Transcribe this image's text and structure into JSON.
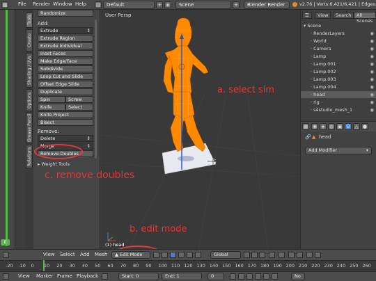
{
  "topbar": {
    "menus": [
      "File",
      "Render",
      "Window",
      "Help"
    ],
    "layout": "Default",
    "scene": "Scene",
    "engine": "Blender Render",
    "stats": "v2.76 | Verts:6,421/6,421 | Edges:16,"
  },
  "tabs": [
    "Tools",
    "Create",
    "Shading / UVs",
    "Options",
    "Grease Pencil",
    "Relations"
  ],
  "toolshelf": {
    "top_button": "Randomize",
    "add_label": "Add:",
    "add_buttons": [
      "Extrude",
      "Extrude Region",
      "Extrude Individual",
      "Inset Faces",
      "Make Edge/Face",
      "Subdivide",
      "Loop Cut and Slide",
      "Offset Edge Slide",
      "Duplicate"
    ],
    "pairs": [
      [
        "Spin",
        "Screw"
      ],
      [
        "Knife",
        "Select"
      ]
    ],
    "more_buttons": [
      "Knife Project",
      "Bisect"
    ],
    "remove_label": "Remove:",
    "delete": "Delete",
    "merge": "Merge",
    "remove_doubles": "Remove Doubles",
    "weight_tools": "Weight Tools"
  },
  "viewport": {
    "label": "User Persp",
    "object_name": "(1) head"
  },
  "annotations": {
    "a": "a. select sim",
    "b": "b. edit mode",
    "c": "c. remove doubles"
  },
  "outliner": {
    "tabs": [
      "View",
      "Search",
      "All Scenes"
    ],
    "rows": [
      {
        "name": "Scene",
        "indent": 0,
        "selected": false
      },
      {
        "name": "RenderLayers",
        "indent": 1,
        "selected": false
      },
      {
        "name": "World",
        "indent": 1,
        "selected": false
      },
      {
        "name": "Camera",
        "indent": 1,
        "selected": false
      },
      {
        "name": "Lamp",
        "indent": 1,
        "selected": false
      },
      {
        "name": "Lamp.001",
        "indent": 1,
        "selected": false
      },
      {
        "name": "Lamp.002",
        "indent": 1,
        "selected": false
      },
      {
        "name": "Lamp.003",
        "indent": 1,
        "selected": false
      },
      {
        "name": "Lamp.004",
        "indent": 1,
        "selected": false
      },
      {
        "name": "head",
        "indent": 1,
        "selected": true
      },
      {
        "name": "rig",
        "indent": 1,
        "selected": false
      },
      {
        "name": "s4studio_mesh_1",
        "indent": 1,
        "selected": false
      }
    ]
  },
  "properties": {
    "breadcrumb": "head",
    "add_modifier": "Add Modifier"
  },
  "viewport_header": {
    "view": "View",
    "select": "Select",
    "add": "Add",
    "mesh": "Mesh",
    "mode": "Edit Mode",
    "orientation": "Global"
  },
  "timeline": {
    "ticks": [
      "-20",
      "-10",
      "0",
      "10",
      "20",
      "30",
      "40",
      "50",
      "60",
      "70",
      "80",
      "90",
      "100",
      "110",
      "120",
      "130",
      "140",
      "150",
      "160",
      "170",
      "180",
      "190",
      "200",
      "210",
      "220",
      "230",
      "240",
      "250",
      "260"
    ]
  },
  "timeline_header": {
    "view": "View",
    "marker": "Marker",
    "frame": "Frame",
    "playback": "Playback",
    "start_label": "Start:",
    "start_value": "0",
    "end_label": "End:",
    "end_value": "1",
    "current": "0",
    "sync": "No"
  },
  "colors": {
    "accent_green": "#57b84a",
    "annotation_red": "#e03a3a",
    "mesh_orange": "#ff8a00",
    "selection_blue": "#4f7dcc"
  }
}
